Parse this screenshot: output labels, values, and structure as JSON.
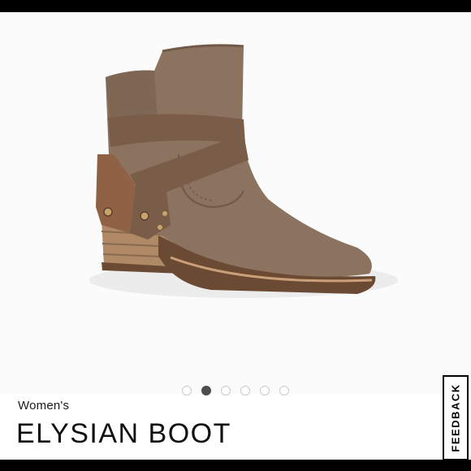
{
  "product": {
    "gender_label": "Women's",
    "name": "ELYSIAN BOOT",
    "image_icon": "ankle-boot-photo"
  },
  "gallery": {
    "image_count": 6,
    "active_index": 1
  },
  "feedback": {
    "label": "FEEDBACK"
  },
  "colors": {
    "leather": "#8b7360",
    "strap": "#7a5d48",
    "heel": "#b08a66",
    "sole": "#6b4a33",
    "pager_active": "#4d4d4d",
    "pager_inactive": "#c9c9c9"
  }
}
